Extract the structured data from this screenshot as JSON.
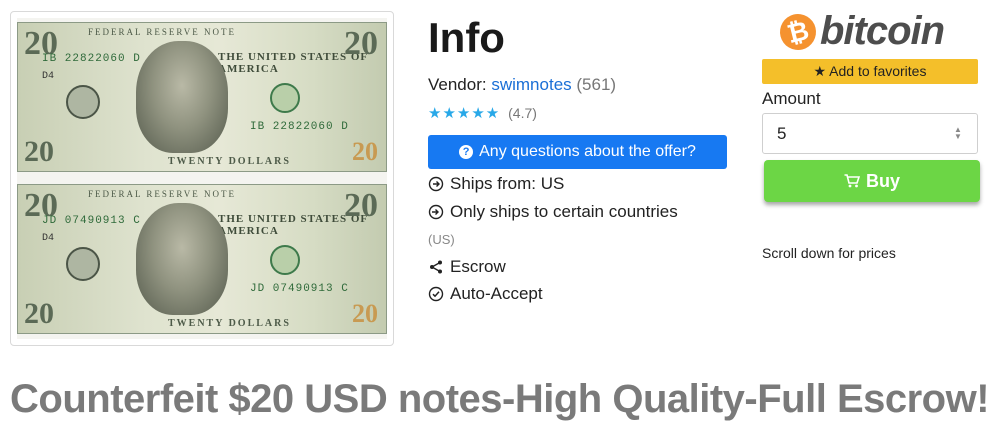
{
  "listing": {
    "image_alt": "Two $20 US dollar notes",
    "note_top": {
      "denomination": "20",
      "serial": "IB 22822060 D",
      "district": "D4",
      "series_label": "FEDERAL RESERVE NOTE",
      "country": "THE UNITED STATES OF AMERICA",
      "bottom_text": "TWENTY DOLLARS"
    },
    "note_bottom": {
      "denomination": "20",
      "serial": "JD 07490913 C",
      "district": "D4",
      "series_label": "FEDERAL RESERVE NOTE",
      "country": "THE UNITED STATES OF AMERICA",
      "bottom_text": "TWENTY DOLLARS"
    },
    "title": "Counterfeit $20 USD notes-High Quality-Full Escrow!"
  },
  "info": {
    "heading": "Info",
    "vendor_label": "Vendor:",
    "vendor_name": "swimnotes",
    "vendor_count": "(561)",
    "stars": "★★★★★",
    "rating": "(4.7)",
    "question_button": "Any questions about the offer?",
    "ships_from": "Ships from: US",
    "ships_to": "Only ships to certain countries",
    "ships_to_note": "(US)",
    "escrow": "Escrow",
    "auto_accept": "Auto-Accept"
  },
  "purchase": {
    "currency_symbol": "₿",
    "currency_name": "bitcoin",
    "favorites_button": "★ Add to favorites",
    "amount_label": "Amount",
    "amount_value": "5",
    "buy_button": "Buy",
    "scroll_note": "Scroll down for prices"
  },
  "colors": {
    "primary_blue": "#1779f2",
    "favorites_yellow": "#f4bf2a",
    "buy_green": "#6cd645",
    "bitcoin_orange": "#f5922f",
    "star_blue": "#28a8e8"
  },
  "icons": {
    "ships_from": "arrow-circle-right-icon",
    "ships_to": "arrow-circle-in-icon",
    "escrow": "share-icon",
    "auto_accept": "check-circle-icon",
    "question": "question-circle-icon",
    "cart": "cart-icon"
  }
}
